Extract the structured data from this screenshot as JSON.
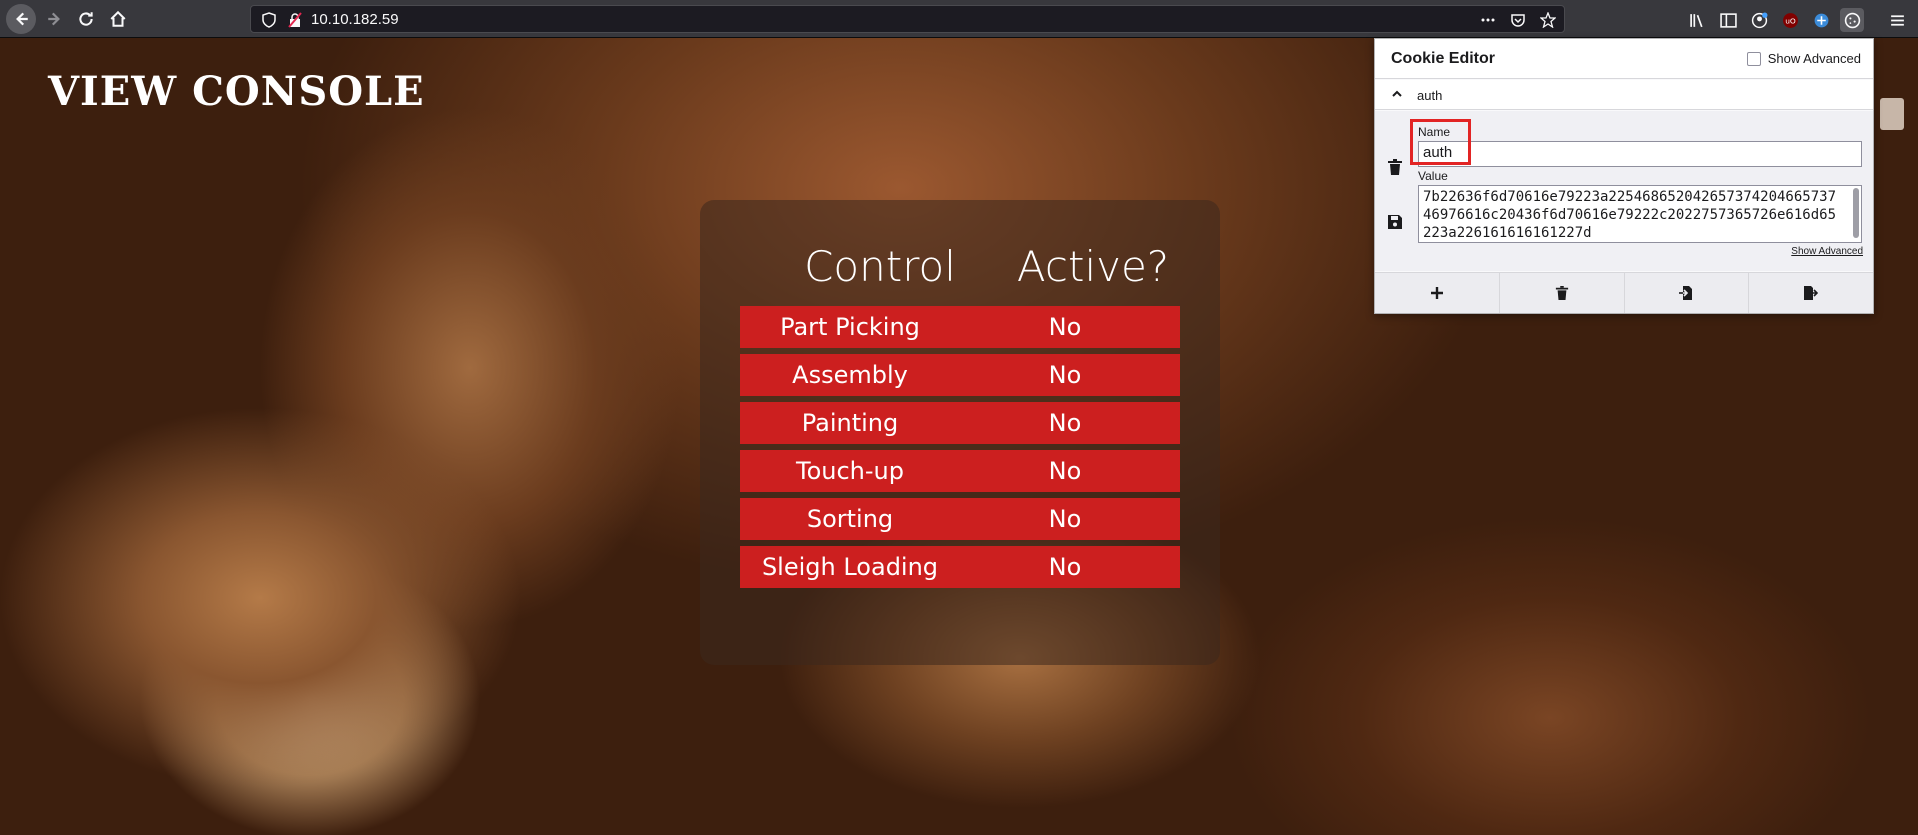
{
  "browser": {
    "url": "10.10.182.59",
    "icons": [
      "back-arrow-icon",
      "forward-arrow-icon",
      "reload-icon",
      "home-icon",
      "shield-icon",
      "insecure-lock-icon",
      "more-dots-icon",
      "pocket-icon",
      "bookmark-star-icon",
      "library-icon",
      "sidebar-icon",
      "account-icon",
      "ublock-icon",
      "extension-icon",
      "cookie-editor-icon",
      "hamburger-menu-icon"
    ]
  },
  "page": {
    "title": "VIEW CONSOLE",
    "table": {
      "headers": [
        "Control",
        "Active?"
      ],
      "rows": [
        {
          "control": "Part Picking",
          "active": "No"
        },
        {
          "control": "Assembly",
          "active": "No"
        },
        {
          "control": "Painting",
          "active": "No"
        },
        {
          "control": "Touch-up",
          "active": "No"
        },
        {
          "control": "Sorting",
          "active": "No"
        },
        {
          "control": "Sleigh Loading",
          "active": "No"
        }
      ]
    }
  },
  "cookie_editor": {
    "title": "Cookie Editor",
    "show_advanced_label": "Show Advanced",
    "cookie_name": "auth",
    "name_label": "Name",
    "name_value": "auth",
    "value_label": "Value",
    "value": "7b22636f6d70616e79223a22546865204265737420466573746976616c20436f6d70616e79222c2022757365726e616d65223a226161616161227d",
    "show_advanced_link": "Show Advanced",
    "colors": {
      "highlight": "#e22424"
    }
  },
  "colors": {
    "row_red": "#cc1f1f",
    "toolbar": "#38383d"
  }
}
